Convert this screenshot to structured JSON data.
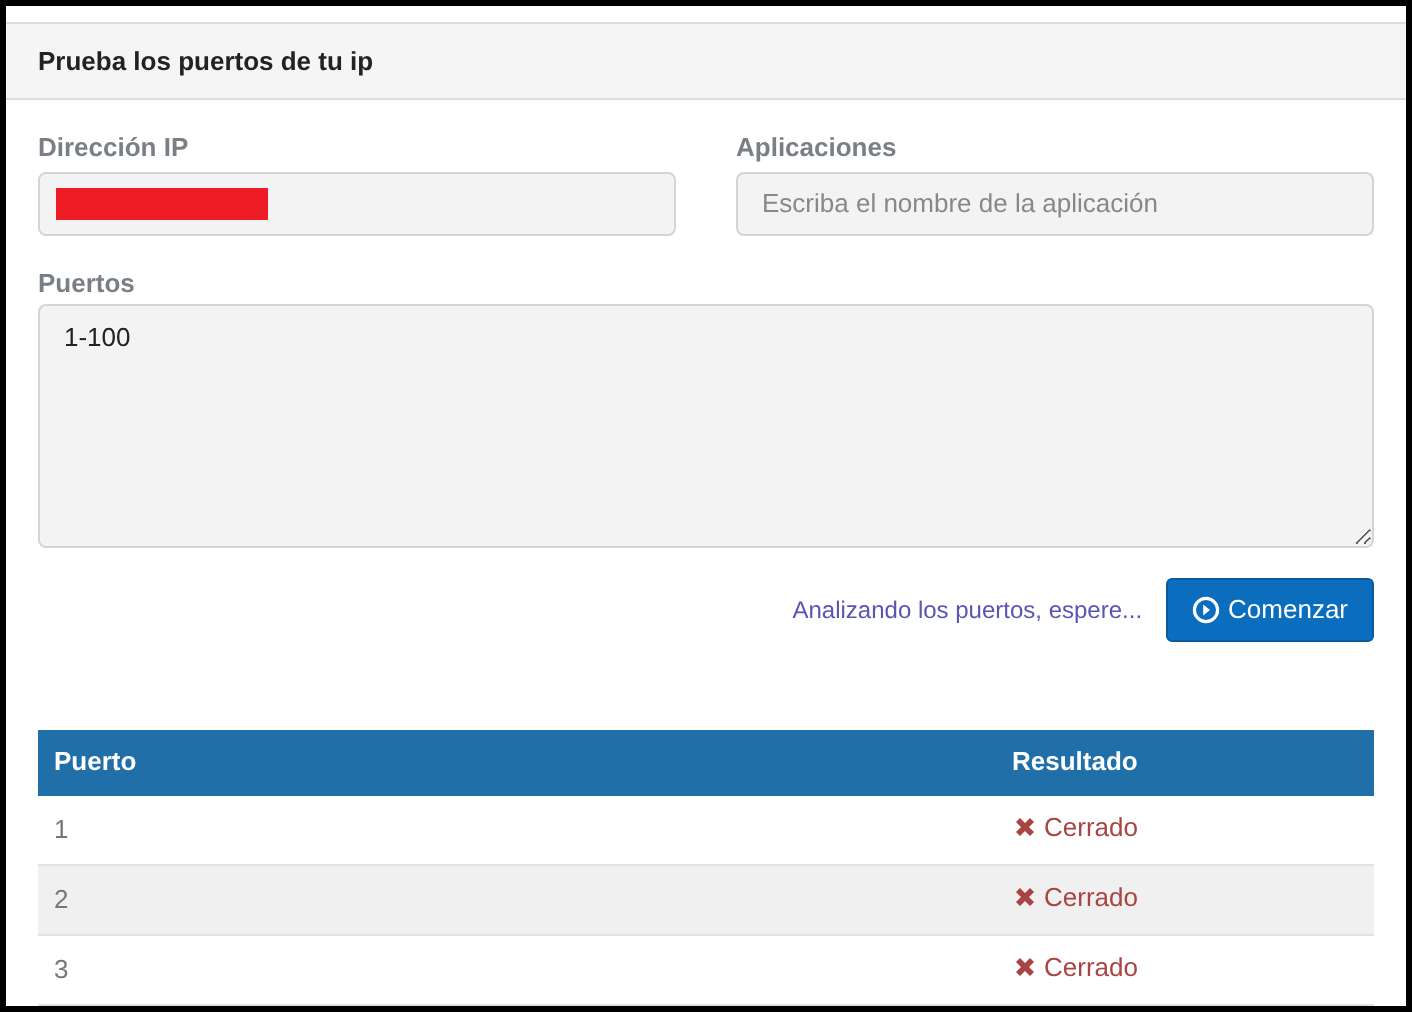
{
  "panel": {
    "title": "Prueba los puertos de tu ip"
  },
  "ip_field": {
    "label": "Dirección IP",
    "redacted": true
  },
  "apps_field": {
    "label": "Aplicaciones",
    "placeholder": "Escriba el nombre de la aplicación"
  },
  "ports_field": {
    "label": "Puertos",
    "value": "1-100"
  },
  "status_text": "Analizando los puertos, espere...",
  "start_button": {
    "label": "Comenzar"
  },
  "table": {
    "columns": [
      "Puerto",
      "Resultado"
    ],
    "rows": [
      {
        "port": "1",
        "result": "Cerrado",
        "kind": "closed"
      },
      {
        "port": "2",
        "result": "Cerrado",
        "kind": "closed"
      },
      {
        "port": "3",
        "result": "Cerrado",
        "kind": "closed"
      }
    ]
  }
}
